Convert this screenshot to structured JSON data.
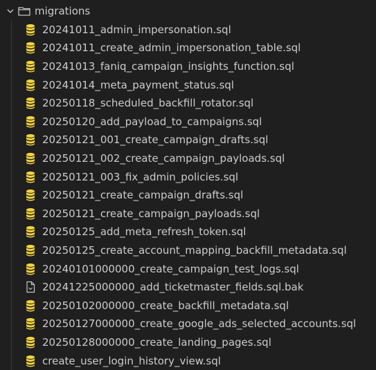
{
  "folder": {
    "name": "migrations",
    "icon": "folder-icon",
    "state": "expanded"
  },
  "colors": {
    "background": "#1f1f1f",
    "text": "#cccccc",
    "db_icon": "#f5d33b",
    "file_icon": "#c5c5c5"
  },
  "files": [
    {
      "name": "20241011_admin_impersonation.sql",
      "icon": "database-icon"
    },
    {
      "name": "20241011_create_admin_impersonation_table.sql",
      "icon": "database-icon"
    },
    {
      "name": "20241013_faniq_campaign_insights_function.sql",
      "icon": "database-icon"
    },
    {
      "name": "20241014_meta_payment_status.sql",
      "icon": "database-icon"
    },
    {
      "name": "20250118_scheduled_backfill_rotator.sql",
      "icon": "database-icon"
    },
    {
      "name": "20250120_add_payload_to_campaigns.sql",
      "icon": "database-icon"
    },
    {
      "name": "20250121_001_create_campaign_drafts.sql",
      "icon": "database-icon"
    },
    {
      "name": "20250121_002_create_campaign_payloads.sql",
      "icon": "database-icon"
    },
    {
      "name": "20250121_003_fix_admin_policies.sql",
      "icon": "database-icon"
    },
    {
      "name": "20250121_create_campaign_drafts.sql",
      "icon": "database-icon"
    },
    {
      "name": "20250121_create_campaign_payloads.sql",
      "icon": "database-icon"
    },
    {
      "name": "20250125_add_meta_refresh_token.sql",
      "icon": "database-icon"
    },
    {
      "name": "20250125_create_account_mapping_backfill_metadata.sql",
      "icon": "database-icon"
    },
    {
      "name": "20240101000000_create_campaign_test_logs.sql",
      "icon": "database-icon"
    },
    {
      "name": "20241225000000_add_ticketmaster_fields.sql.bak",
      "icon": "file-icon"
    },
    {
      "name": "20250102000000_create_backfill_metadata.sql",
      "icon": "database-icon"
    },
    {
      "name": "20250127000000_create_google_ads_selected_accounts.sql",
      "icon": "database-icon"
    },
    {
      "name": "20250128000000_create_landing_pages.sql",
      "icon": "database-icon"
    },
    {
      "name": "create_user_login_history_view.sql",
      "icon": "database-icon"
    }
  ]
}
